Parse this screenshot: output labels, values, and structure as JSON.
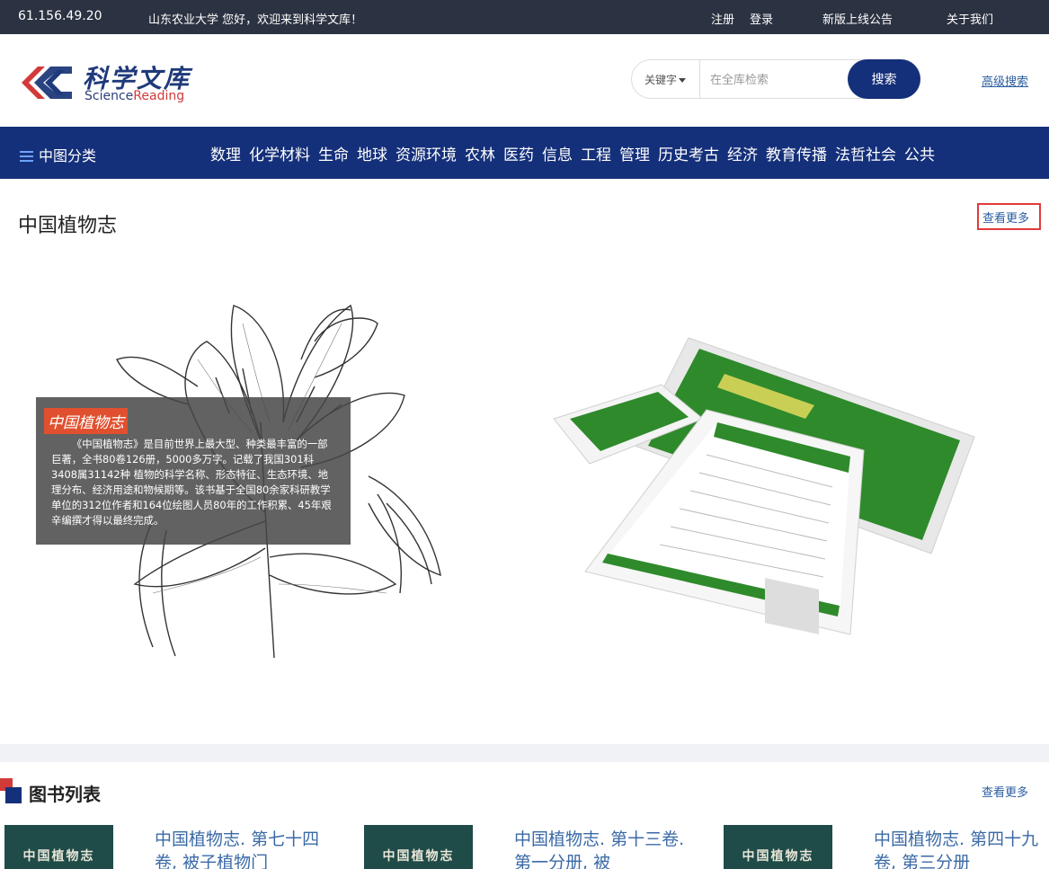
{
  "topbar": {
    "ip": "61.156.49.20",
    "welcome": "山东农业大学 您好，欢迎来到科学文库！",
    "register": "注册",
    "login": "登录",
    "notice": "新版上线公告",
    "about": "关于我们"
  },
  "header": {
    "logo_cn": "科学文库",
    "logo_en_prefix": "Science",
    "logo_en_suffix": "Reading",
    "search_type": "关键字",
    "search_placeholder": "在全库检索",
    "search_button": "搜索",
    "advanced_search": "高级搜索"
  },
  "nav": {
    "category_label": "中图分类",
    "items": [
      "数理",
      "化学材料",
      "生命",
      "地球",
      "资源环境",
      "农林",
      "医药",
      "信息",
      "工程",
      "管理",
      "历史考古",
      "经济",
      "教育传播",
      "法哲社会",
      "公共"
    ]
  },
  "feature": {
    "title": "中国植物志",
    "see_more": "查看更多",
    "overlay_title": "中国植物志",
    "overlay_text": "《中国植物志》是目前世界上最大型、种类最丰富的一部巨著，全书80卷126册，5000多万字。记载了我国301科3408属31142种 植物的科学名称、形态特征、生态环境、地理分布、经济用途和物候期等。该书基于全国80余家科研教学单位的312位作者和164位绘图人员80年的工作积累、45年艰辛编撰才得以最终完成。"
  },
  "books": {
    "title": "图书列表",
    "see_more": "查看更多",
    "items": [
      {
        "cover": "中国植物志",
        "title": "中国植物志. 第七十四卷, 被子植物门"
      },
      {
        "cover": "中国植物志",
        "title": "中国植物志. 第十三卷. 第一分册, 被"
      },
      {
        "cover": "中国植物志",
        "title": "中国植物志. 第四十九卷, 第三分册"
      }
    ]
  },
  "colors": {
    "topbar": "#2b3241",
    "nav": "#15307a",
    "accent_red": "#e23a3a",
    "link": "#2a5d9f"
  }
}
